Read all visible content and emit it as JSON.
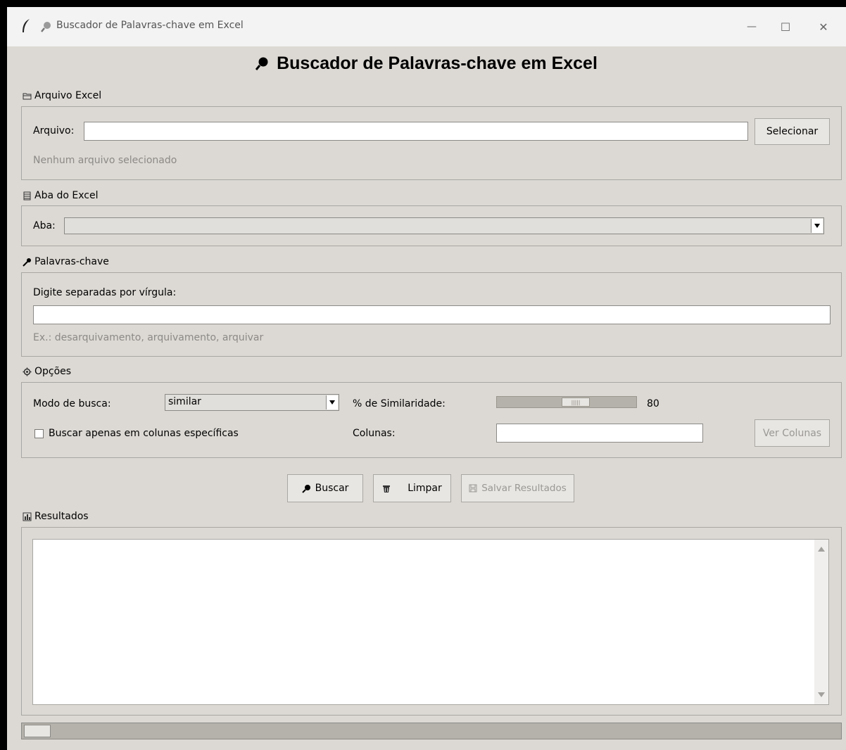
{
  "window": {
    "title": "Buscador de Palavras-chave em Excel",
    "min_glyph": "—",
    "max_glyph": "☐",
    "close_glyph": "✕"
  },
  "app_title": "Buscador de Palavras-chave em Excel",
  "arquivo": {
    "group_label": "Arquivo Excel",
    "field_label": "Arquivo:",
    "value": "",
    "button": "Selecionar",
    "status": "Nenhum arquivo selecionado"
  },
  "aba": {
    "group_label": "Aba do Excel",
    "field_label": "Aba:",
    "selected": ""
  },
  "palavras": {
    "group_label": "Palavras-chave",
    "instruction": "Digite separadas por vírgula:",
    "value": "",
    "example": "Ex.: desarquivamento, arquivamento, arquivar"
  },
  "opcoes": {
    "group_label": "Opções",
    "modo_label": "Modo de busca:",
    "modo_value": "similar",
    "similaridade_label": "% de Similaridade:",
    "similaridade_value": "80",
    "similaridade_level": 80,
    "checkbox_label": "Buscar apenas em colunas específicas",
    "checkbox_checked": false,
    "colunas_label": "Colunas:",
    "colunas_value": "",
    "ver_colunas_button": "Ver Colunas"
  },
  "actions": {
    "buscar": "Buscar",
    "limpar": "Limpar",
    "salvar": "Salvar Resultados"
  },
  "resultados": {
    "group_label": "Resultados",
    "content": ""
  },
  "icons": {
    "app": "feather-icon",
    "search": "magnifier-icon",
    "folder": "folder-icon",
    "sheet": "spreadsheet-icon",
    "key": "key-icon",
    "gear": "gear-icon",
    "trash": "trash-icon",
    "save": "floppy-icon",
    "chart": "bar-chart-icon"
  }
}
